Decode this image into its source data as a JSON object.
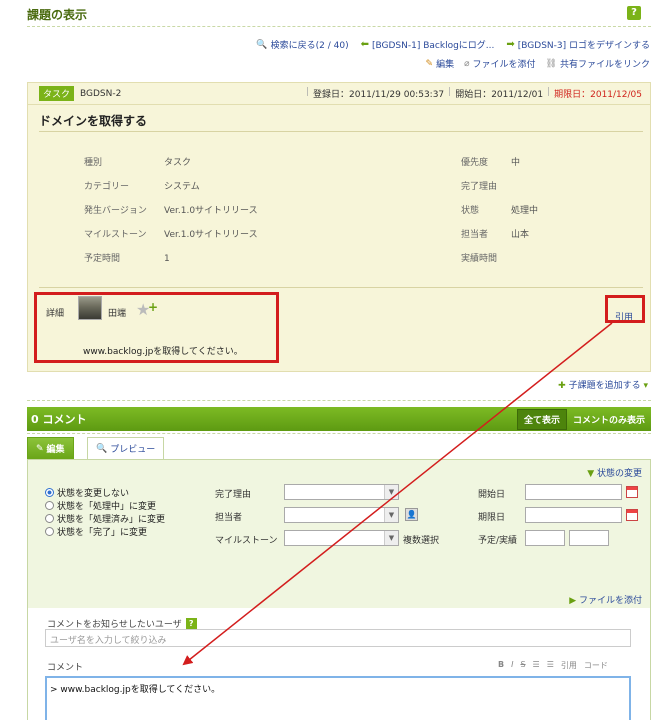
{
  "page": {
    "title": "課題の表示",
    "help": "?"
  },
  "nav": {
    "back": "検索に戻る(2 / 40)",
    "prev": "[BGDSN-1] Backlogにログ...",
    "next": "[BGDSN-3] ロゴをデザインする"
  },
  "actions": {
    "edit": "編集",
    "attach": "ファイルを添付",
    "link_shared": "共有ファイルをリンク"
  },
  "issue": {
    "type": "タスク",
    "key": "BGDSN-2",
    "created": "登録日：2011/11/29 00:53:37",
    "start": "開始日：2011/12/01",
    "due": "期限日：2011/12/05",
    "title": "ドメインを取得する",
    "attrs_left": [
      {
        "key": "種別",
        "value": "タスク"
      },
      {
        "key": "カテゴリー",
        "value": "システム"
      },
      {
        "key": "発生バージョン",
        "value": "Ver.1.0サイトリリース"
      },
      {
        "key": "マイルストーン",
        "value": "Ver.1.0サイトリリース"
      },
      {
        "key": "予定時間",
        "value": "1"
      }
    ],
    "attrs_right": [
      {
        "key": "優先度",
        "value": "中"
      },
      {
        "key": "完了理由",
        "value": ""
      },
      {
        "key": "状態",
        "value": "処理中"
      },
      {
        "key": "担当者",
        "value": "山本"
      },
      {
        "key": "実績時間",
        "value": ""
      }
    ],
    "detail_label": "詳細",
    "author": "田端",
    "description": "www.backlog.jpを取得してください。",
    "quote": "引用"
  },
  "add_child": "子課題を追加する",
  "comments": {
    "count_label": "0 コメント",
    "show_all": "全て表示",
    "comments_only": "コメントのみ表示"
  },
  "tabs": {
    "edit": "編集",
    "preview": "プレビュー"
  },
  "form": {
    "status_change": "状態の変更",
    "radios": [
      "状態を変更しない",
      "状態を「処理中」に変更",
      "状態を「処理済み」に変更",
      "状態を「完了」に変更"
    ],
    "labels": {
      "resolution": "完了理由",
      "assignee": "担当者",
      "milestone": "マイルストーン",
      "multi": "複数選択",
      "start": "開始日",
      "due": "期限日",
      "estimate": "予定/実績"
    },
    "attach_file": "ファイルを添付",
    "notify_label": "コメントをお知らせしたいユーザ",
    "notify_placeholder": "ユーザ名を入力して絞り込み",
    "comment_label": "コメント",
    "toolbar": [
      "B",
      "I",
      "S",
      "☰",
      "☰",
      "引用",
      "コード"
    ],
    "comment_value": "> www.backlog.jpを取得してください。"
  },
  "colors": {
    "accent": "#7bb318",
    "highlight": "#d31d1d",
    "link": "#2b4a9a"
  }
}
